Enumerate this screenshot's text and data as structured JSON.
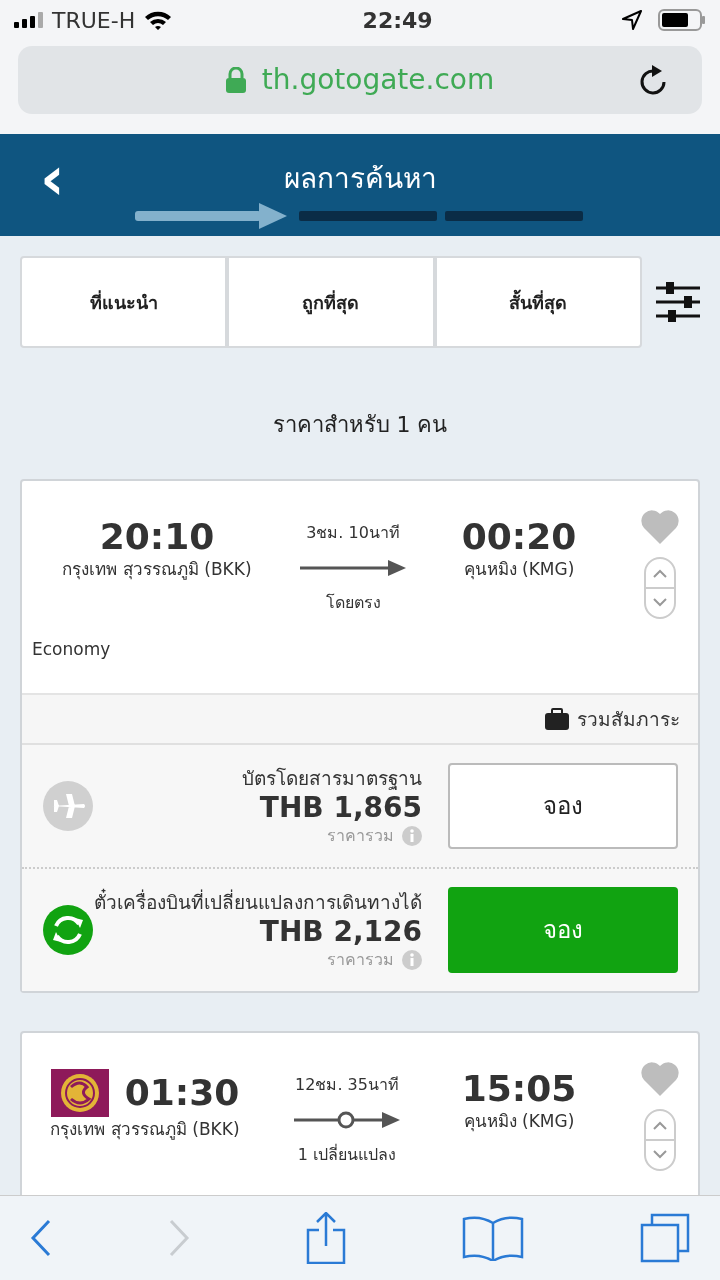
{
  "status_bar": {
    "carrier": "TRUE-H",
    "time": "22:49"
  },
  "browser": {
    "url": "th.gotogate.com"
  },
  "header": {
    "back": "‹",
    "title": "ผลการค้นหา",
    "steps": [
      {
        "selected": true
      },
      {
        "selected": false
      },
      {
        "selected": false
      }
    ]
  },
  "sort_tabs": [
    {
      "label": "ที่แนะนำ",
      "selected": false
    },
    {
      "label": "ถูกที่สุด",
      "selected": false
    },
    {
      "label": "สั้นที่สุด",
      "selected": false
    }
  ],
  "price_note": "ราคาสำหรับ 1 คน",
  "flights": [
    {
      "logo": false,
      "depart_time": "20:10",
      "depart_airport": "กรุงเทพ สุวรรณภูมิ (BKK)",
      "duration": "3ชม. 10นาที",
      "kind": "direct",
      "stops": "โดยตรง",
      "arrive_time": "00:20",
      "arrive_airport": "คุนหมิง (KMG)",
      "cabin": "Economy",
      "baggage": "รวมสัมภาระ",
      "fares": [
        {
          "kind": "standard",
          "name": "บัตรโดยสารมาตรฐาน",
          "price": "THB 1,865",
          "total_label": "ราคารวม",
          "button": "จอง"
        },
        {
          "kind": "flexible",
          "name": "ตั๋วเครื่องบินที่เปลี่ยนแปลงการเดินทางได้",
          "price": "THB 2,126",
          "total_label": "ราคารวม",
          "button": "จอง"
        }
      ]
    },
    {
      "logo": true,
      "depart_time": "01:30",
      "depart_airport": "กรุงเทพ สุวรรณภูมิ (BKK)",
      "duration": "12ชม. 35นาที",
      "kind": "connecting",
      "stops": "1 เปลี่ยนแปลง",
      "arrive_time": "15:05",
      "arrive_airport": "คุนหมิง (KMG)"
    }
  ],
  "toolbar": {
    "back_disabled": false,
    "forward_disabled": true
  }
}
